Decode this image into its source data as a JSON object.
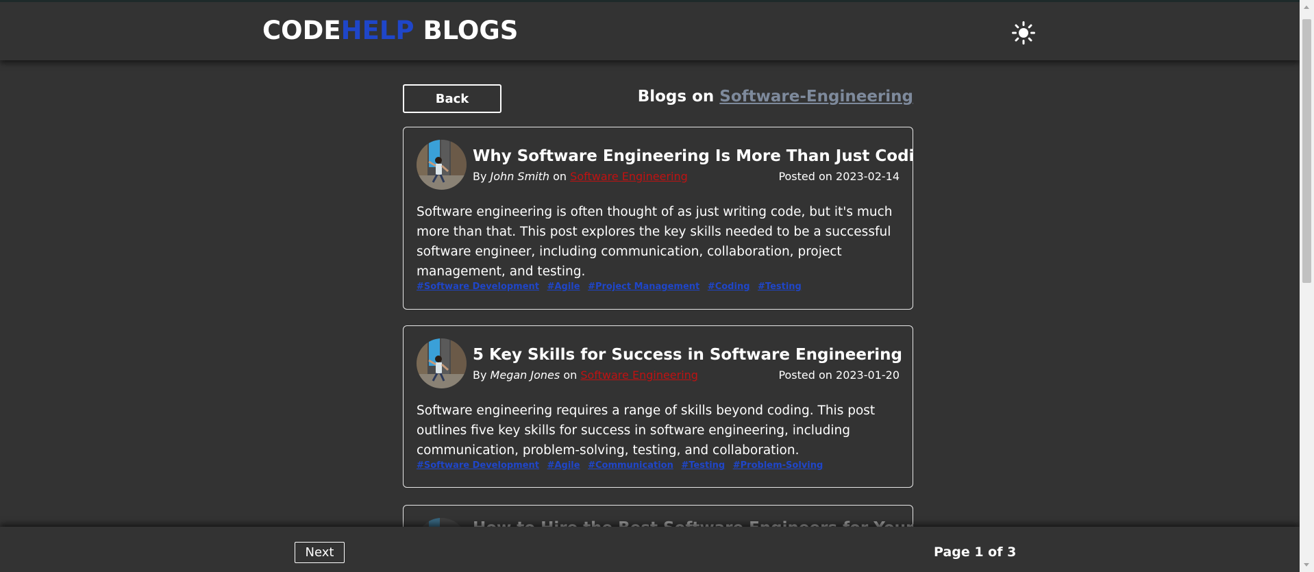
{
  "header": {
    "brand_part1": "CODE",
    "brand_part2": "HELP",
    "brand_part3": "BLOGS",
    "theme_icon": "sun-icon"
  },
  "toolbar": {
    "back_label": "Back",
    "blogs_on_prefix": "Blogs on",
    "category": "Software-Engineering"
  },
  "posts": [
    {
      "title": "Why Software Engineering Is More Than Just Coding",
      "by_prefix": "By",
      "author": "John Smith",
      "on_word": "on",
      "category": "Software Engineering",
      "date_label": "Posted on 2023-02-14",
      "content": "Software engineering is often thought of as just writing code, but it's much more than that. This post explores the key skills needed to be a successful software engineer, including communication, collaboration, project management, and testing.",
      "tags": [
        "#Software Development",
        "#Agile",
        "#Project Management",
        "#Coding",
        "#Testing"
      ]
    },
    {
      "title": "5 Key Skills for Success in Software Engineering",
      "by_prefix": "By",
      "author": "Megan Jones",
      "on_word": "on",
      "category": "Software Engineering",
      "date_label": "Posted on 2023-01-20",
      "content": "Software engineering requires a range of skills beyond coding. This post outlines five key skills for success in software engineering, including communication, problem-solving, testing, and collaboration.",
      "tags": [
        "#Software Development",
        "#Agile",
        "#Communication",
        "#Testing",
        "#Problem-Solving"
      ]
    },
    {
      "title": "How to Hire the Best Software Engineers for Your"
    }
  ],
  "footer": {
    "next_label": "Next",
    "page_info": "Page 1 of 3"
  },
  "colors": {
    "background": "#333333",
    "accent_blue": "#1f46c9",
    "category_red": "#c01212",
    "category_gray": "#7e8a9c"
  }
}
